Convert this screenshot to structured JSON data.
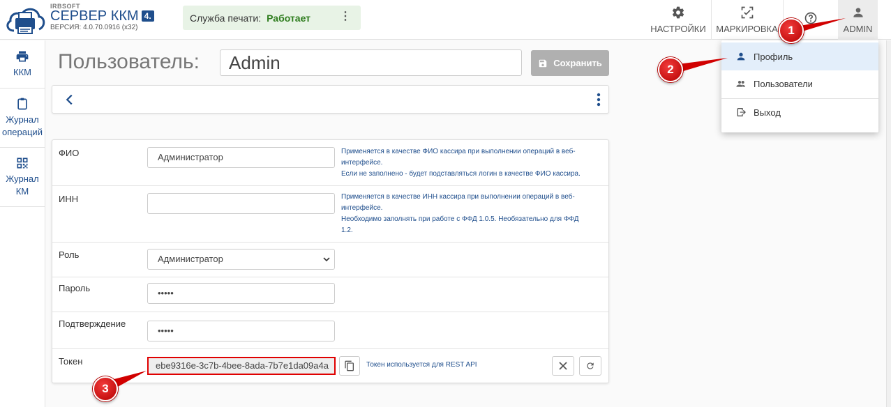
{
  "header": {
    "brand_small": "IRBSOFT",
    "brand_title": "СЕРВЕР ККМ",
    "brand_badge": "4.",
    "version": "ВЕРСИЯ: 4.0.70.0916 (x32)",
    "service_label": "Служба печати:",
    "service_status": "Работает",
    "nav": {
      "settings": "НАСТРОЙКИ",
      "marking": "МАРКИРОВКА",
      "admin": "ADMIN"
    }
  },
  "sidebar": {
    "items": [
      {
        "label": "ККМ",
        "icon": "printer-icon"
      },
      {
        "label": "Журнал операций",
        "line1": "Журнал",
        "line2": "операций",
        "icon": "clipboard-icon"
      },
      {
        "label": "Журнал КМ",
        "line1": "Журнал",
        "line2": "КМ",
        "icon": "qr-code-icon"
      }
    ]
  },
  "main": {
    "title": "Пользователь:",
    "user_value": "Admin",
    "save_label": "Сохранить"
  },
  "form": {
    "fio": {
      "label": "ФИО",
      "value": "Администратор",
      "hint1": "Применяется в качестве ФИО кассира при выполнении операций в веб-",
      "hint2": "интерфейсе.",
      "hint3": "Если не заполнено - будет подставляться логин в качестве ФИО кассира."
    },
    "inn": {
      "label": "ИНН",
      "value": "",
      "hint1": "Применяется в качестве ИНН кассира при выполнении операций в веб-",
      "hint2": "интерфейсе.",
      "hint3": "Необходимо заполнять при работе с ФФД 1.0.5. Необязательно для ФФД",
      "hint4": "1.2."
    },
    "role": {
      "label": "Роль",
      "value": "Администратор"
    },
    "password": {
      "label": "Пароль",
      "value": "•••••"
    },
    "confirm": {
      "label": "Подтверждение",
      "value": "•••••"
    },
    "token": {
      "label": "Токен",
      "value": "ebe9316e-3c7b-4bee-8ada-7b7e1da09a4a",
      "hint": "Токен используется для REST API"
    }
  },
  "dropdown": {
    "items": [
      {
        "label": "Профиль",
        "icon": "person-icon"
      },
      {
        "label": "Пользователи",
        "icon": "people-icon"
      },
      {
        "label": "Выход",
        "icon": "logout-icon"
      }
    ]
  },
  "annotations": [
    "1",
    "2",
    "3"
  ],
  "colors": {
    "brand": "#1f4e8c",
    "status_ok": "#2f7d1f",
    "service_bg": "#e8f3e6",
    "marker": "#d10000",
    "active_item": "#e3eefa"
  }
}
